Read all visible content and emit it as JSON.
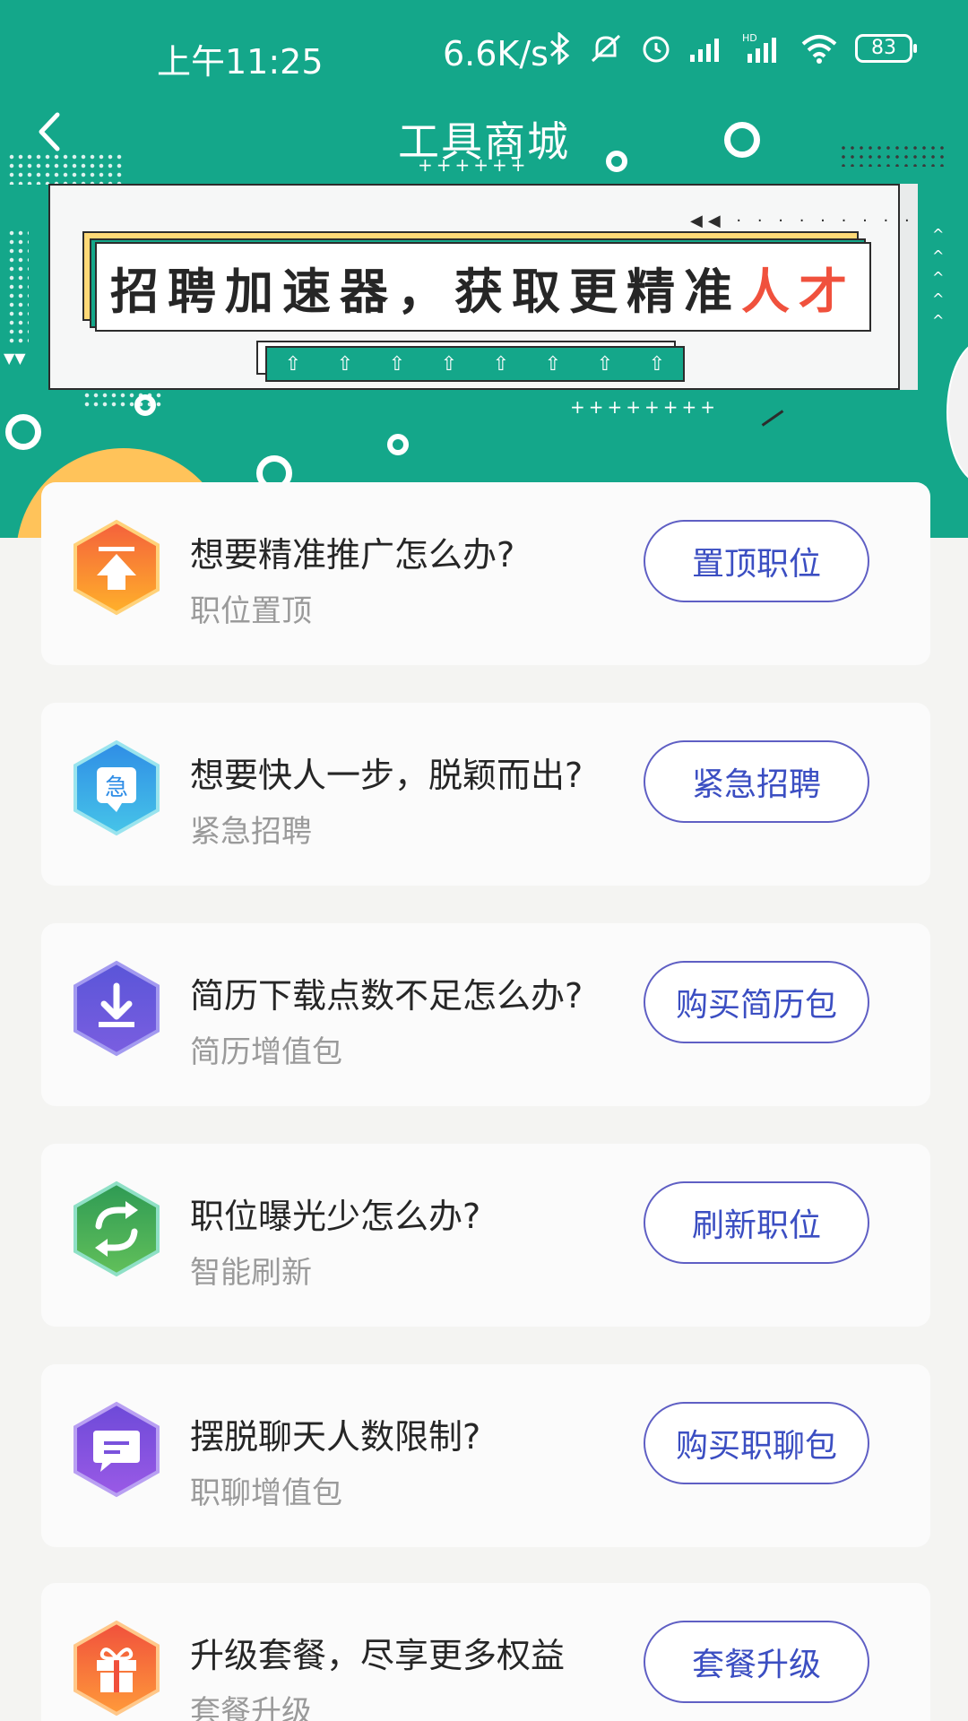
{
  "status_bar": {
    "time": "上午11:25",
    "network_speed": "6.6K/s",
    "icons": [
      "bluetooth-icon",
      "mute-icon",
      "alarm-icon",
      "signal-icon",
      "hd-signal-icon",
      "wifi-icon"
    ],
    "battery": "83"
  },
  "nav": {
    "title": "工具商城",
    "back_icon": "chevron-left-icon"
  },
  "banner": {
    "text_main": "招聘加速器，获取更精准",
    "text_highlight": "人才",
    "highlight_color": "#f0513d"
  },
  "colors": {
    "header": "#14a78a",
    "button_border": "#5f5fc4",
    "button_text": "#3b4ec2"
  },
  "cards": [
    {
      "title": "想要精准推广怎么办?",
      "subtitle": "职位置顶",
      "button": "置顶职位",
      "icon": "pin-top-icon"
    },
    {
      "title": "想要快人一步，脱颖而出?",
      "subtitle": "紧急招聘",
      "button": "紧急招聘",
      "icon": "urgent-icon",
      "icon_text": "急"
    },
    {
      "title": "简历下载点数不足怎么办?",
      "subtitle": "简历增值包",
      "button": "购买简历包",
      "icon": "download-icon"
    },
    {
      "title": "职位曝光少怎么办?",
      "subtitle": "智能刷新",
      "button": "刷新职位",
      "icon": "refresh-icon"
    },
    {
      "title": "摆脱聊天人数限制?",
      "subtitle": "职聊增值包",
      "button": "购买职聊包",
      "icon": "chat-icon"
    },
    {
      "title": "升级套餐，尽享更多权益",
      "subtitle": "套餐升级",
      "button": "套餐升级",
      "icon": "gift-icon"
    }
  ]
}
